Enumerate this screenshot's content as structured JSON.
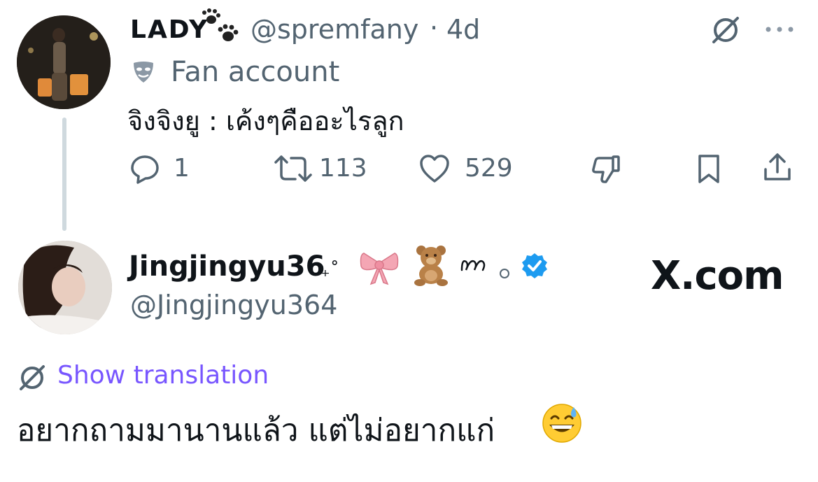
{
  "tweet1": {
    "display_name": "LADY",
    "name_decoration_icon": "paw-prints-icon",
    "handle": "@spremfany",
    "separator": "·",
    "time": "4d",
    "label_icon": "mask-icon",
    "label": "Fan account",
    "text": "จิงจิงยู : เค้งๆคืออะไรลูก",
    "replies": "1",
    "retweets": "113",
    "likes": "529"
  },
  "tweet2": {
    "display_name": "Jingjingyu36",
    "name_decorations": [
      "sparkle",
      "ribbon",
      "teddy-bear",
      "squiggle",
      "small-circle"
    ],
    "sparkle_text": "₊˚",
    "handle": "@Jingjingyu364",
    "verified": true,
    "show_translation": "Show translation",
    "text": "อยากถามมานานแล้ว แต่ไม่อยากแก่",
    "trailing_emoji": "grinning-face-with-sweat"
  },
  "watermark": "X.com",
  "colors": {
    "text_primary": "#0f1419",
    "text_secondary": "#536471",
    "link_purple": "#7856ff",
    "verified_blue": "#1d9bf0",
    "thread_line": "#cfd9de"
  }
}
